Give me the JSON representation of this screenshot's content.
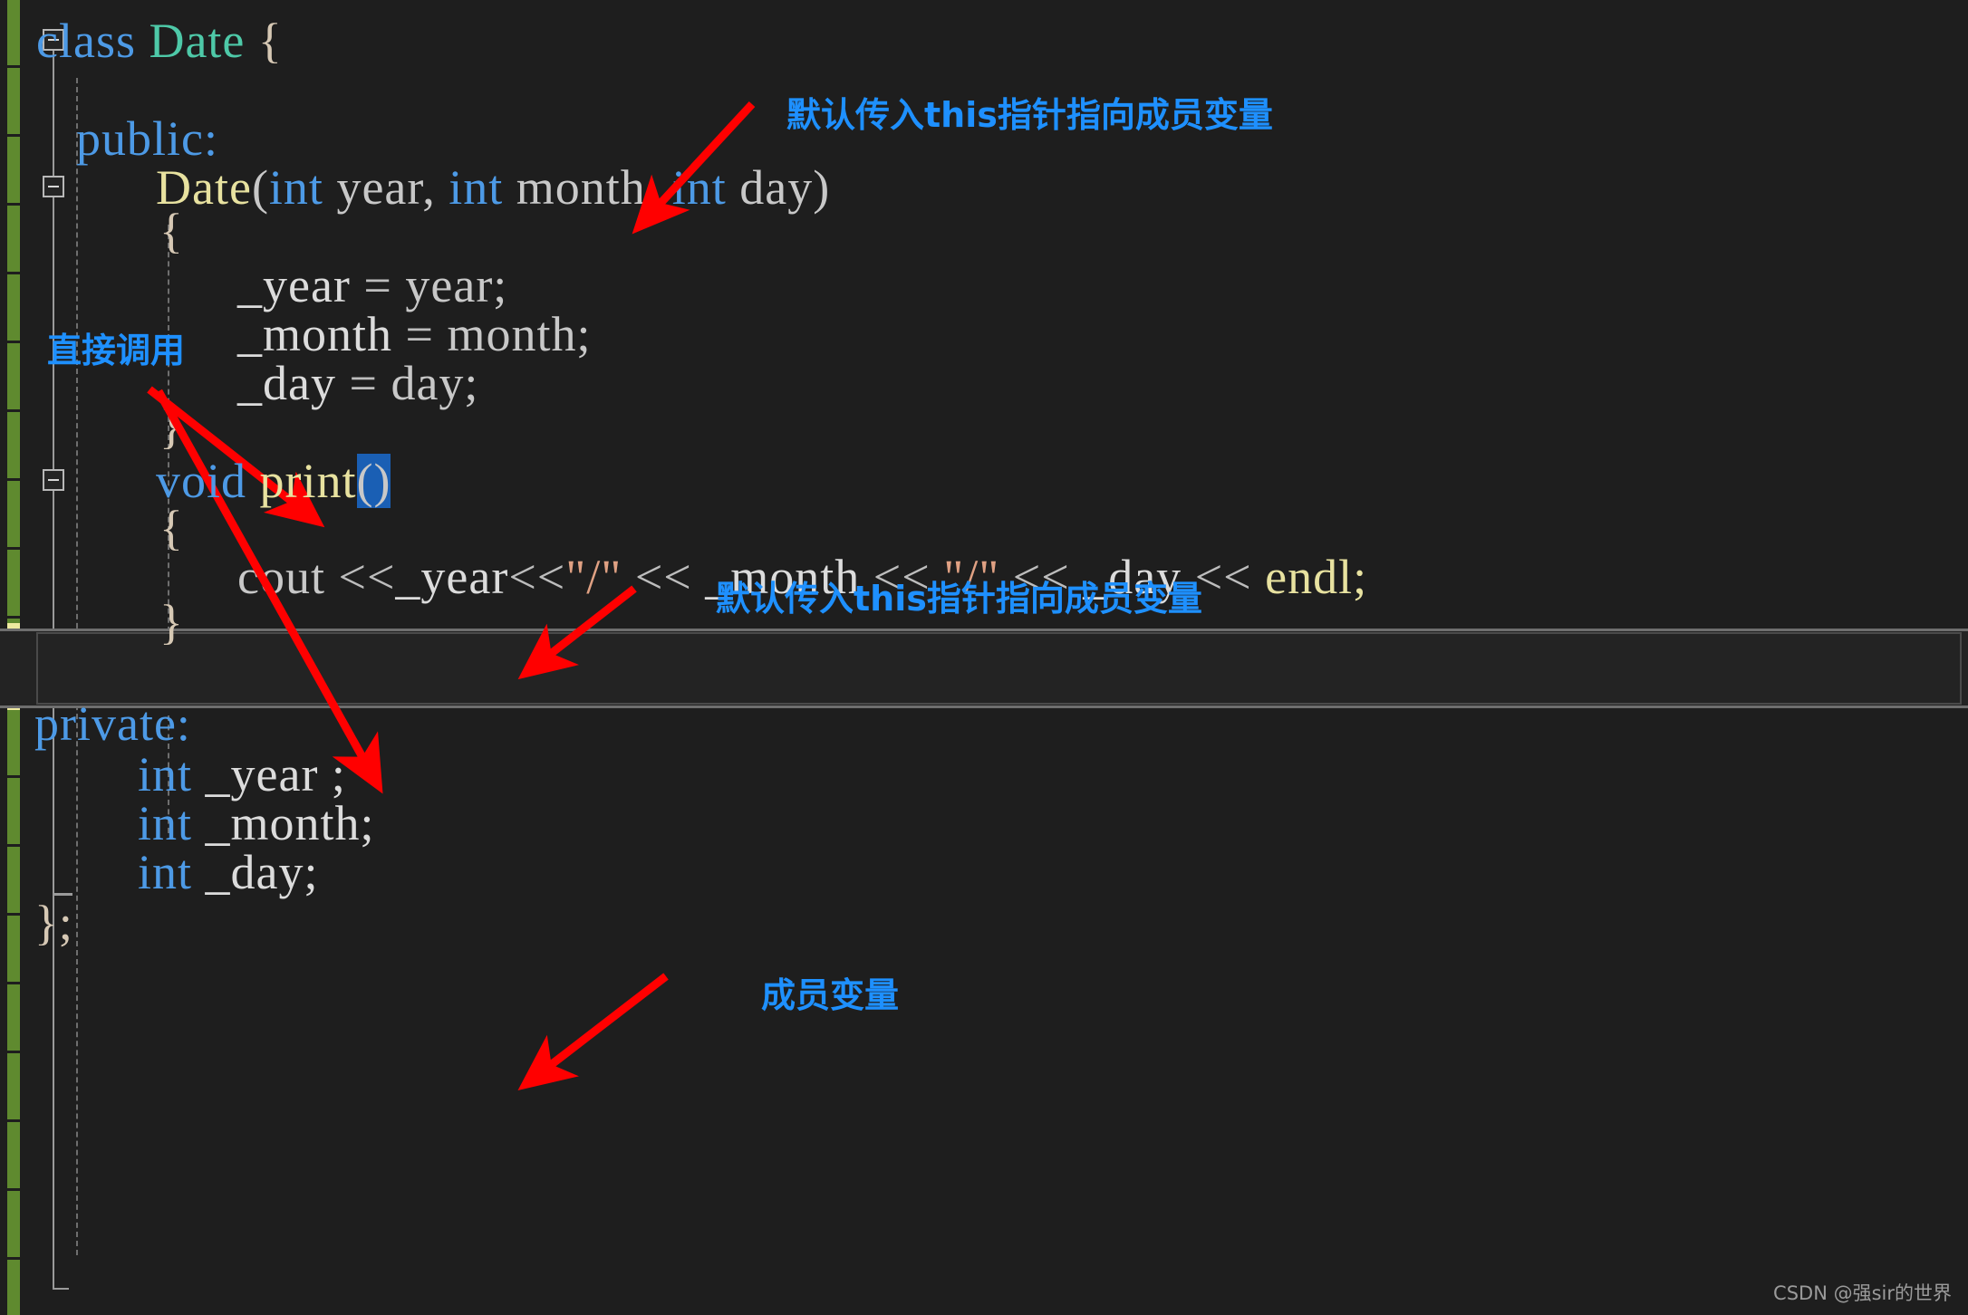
{
  "editor": {
    "background_color": "#1e1e1e",
    "current_line_background": "#232323",
    "selection_color": "#1a5fb4",
    "change_bar_saved_color": "#5f8a2f",
    "change_bar_unsaved_color": "#eeeaa0",
    "code_lines": [
      {
        "id": "line-class-date",
        "text": "class Date {"
      },
      {
        "id": "line-blank-1",
        "text": ""
      },
      {
        "id": "line-public",
        "text": "  public:"
      },
      {
        "id": "line-ctor-sig",
        "text": "      Date(int year, int month, int day)"
      },
      {
        "id": "line-ctor-open",
        "text": "      {"
      },
      {
        "id": "line-assign-year",
        "text": "          _year = year;"
      },
      {
        "id": "line-assign-month",
        "text": "          _month = month;"
      },
      {
        "id": "line-assign-day",
        "text": "          _day = day;"
      },
      {
        "id": "line-ctor-close",
        "text": "      }"
      },
      {
        "id": "line-print-sig",
        "text": "      void print()"
      },
      {
        "id": "line-print-open",
        "text": "      {"
      },
      {
        "id": "line-cout",
        "text": "          cout <<_year<<\"/\" << _month << \"/\" << _day << endl;"
      },
      {
        "id": "line-print-close",
        "text": "      }"
      },
      {
        "id": "line-blank-2",
        "text": ""
      },
      {
        "id": "line-private",
        "text": "private:"
      },
      {
        "id": "line-member-year",
        "text": "    int _year ;"
      },
      {
        "id": "line-member-month",
        "text": "    int _month;"
      },
      {
        "id": "line-member-day",
        "text": "    int _day;"
      },
      {
        "id": "line-class-close",
        "text": "};"
      }
    ],
    "selected_text": "()",
    "current_line_text": "void print()"
  },
  "tokens": {
    "kw_class": "class",
    "type_date": "Date",
    "brace_open": "{",
    "kw_public": "public:",
    "ctor_name": "Date",
    "paren_open": "(",
    "kw_int": "int",
    "param_year": "year,",
    "param_month": "month,",
    "param_day": "day",
    "paren_close": ")",
    "member_year": "_year",
    "member_month": "_month",
    "member_day": "_day",
    "assign": "=",
    "arg_year": "year;",
    "arg_month": "month;",
    "arg_day": "day;",
    "brace_close": "}",
    "kw_void": "void",
    "fn_print": "print",
    "parens_empty": "()",
    "cout": "cout",
    "shift": "<<",
    "slash_string": "\"/\"",
    "endl": "endl;",
    "kw_private": "private:",
    "member_year_decl": "_year ;",
    "member_month_decl": "_month;",
    "member_day_decl": "_day;",
    "class_end": "};"
  },
  "annotations": [
    {
      "id": "annotation-this-pointer-ctor",
      "text": "默认传入this指针指向成员变量",
      "color": "#1e90ff"
    },
    {
      "id": "annotation-direct-call",
      "text": "直接调用",
      "color": "#1e90ff"
    },
    {
      "id": "annotation-this-pointer-print",
      "text": "默认传入this指针指向成员变量",
      "color": "#1e90ff"
    },
    {
      "id": "annotation-member-variables",
      "text": "成员变量",
      "color": "#1e90ff"
    }
  ],
  "arrow_color": "#ff0000",
  "watermark": {
    "text": "CSDN @强sir的世界"
  }
}
